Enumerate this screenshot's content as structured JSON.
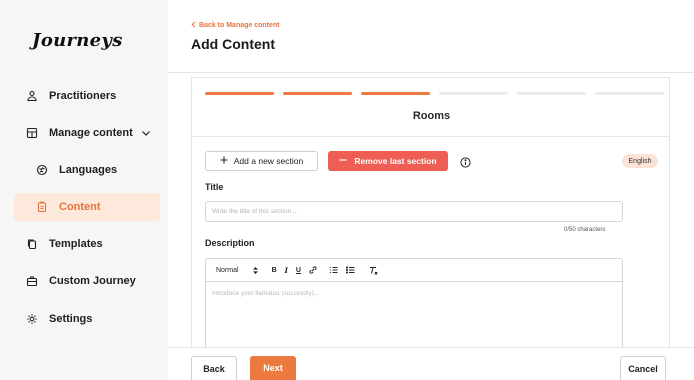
{
  "app": {
    "logo": "Journeys"
  },
  "sidebar": {
    "items": [
      {
        "label": "Practitioners",
        "icon": "users-icon"
      },
      {
        "label": "Manage content",
        "icon": "layout-icon",
        "expanded": true
      },
      {
        "label": "Languages",
        "icon": "globe-icon"
      },
      {
        "label": "Content",
        "icon": "clipboard-icon",
        "active": true
      },
      {
        "label": "Templates",
        "icon": "copy-icon"
      },
      {
        "label": "Custom Journey",
        "icon": "briefcase-icon"
      },
      {
        "label": "Settings",
        "icon": "gear-icon"
      }
    ]
  },
  "header": {
    "back_label": "Back to Manage content",
    "title": "Add Content"
  },
  "steps": {
    "total": 6,
    "completed": 3
  },
  "section": {
    "name": "Rooms",
    "add_label": "Add a new section",
    "remove_label": "Remove last section",
    "language": "English"
  },
  "form": {
    "title_label": "Title",
    "title_placeholder": "Write the title of this section...",
    "char_count": "0/50 characters",
    "description_label": "Description",
    "toolbar": {
      "format": "Normal",
      "bold": "B",
      "italic": "I",
      "underline": "U"
    },
    "description_placeholder": "Introduce your llamatus (succinctly)..."
  },
  "footer": {
    "back_label": "Back",
    "next_label": "Next",
    "cancel_label": "Cancel"
  },
  "colors": {
    "accent": "#ec7a3e",
    "danger": "#ee5e54",
    "active_bg": "#fde9dc",
    "badge_bg": "#fde3d3"
  }
}
